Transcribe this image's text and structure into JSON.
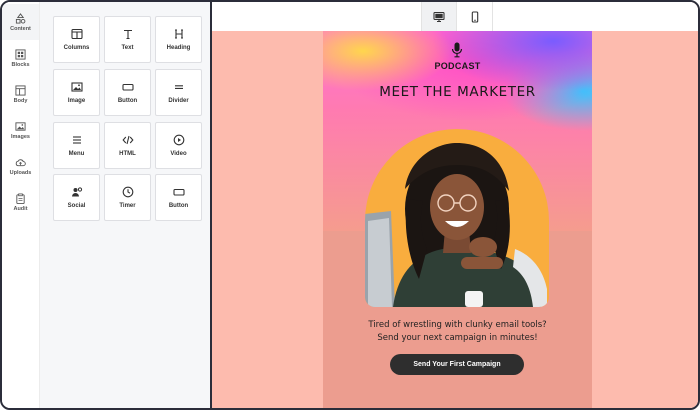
{
  "sidebar": {
    "items": [
      {
        "label": "Content",
        "icon": "shapes-icon",
        "active": true
      },
      {
        "label": "Blocks",
        "icon": "blocks-icon"
      },
      {
        "label": "Body",
        "icon": "body-layout-icon"
      },
      {
        "label": "Images",
        "icon": "image-icon"
      },
      {
        "label": "Uploads",
        "icon": "cloud-upload-icon"
      },
      {
        "label": "Audit",
        "icon": "clipboard-icon"
      }
    ]
  },
  "tools": [
    {
      "label": "Columns",
      "icon": "columns-icon"
    },
    {
      "label": "Text",
      "icon": "text-icon"
    },
    {
      "label": "Heading",
      "icon": "heading-icon"
    },
    {
      "label": "Image",
      "icon": "image-icon"
    },
    {
      "label": "Button",
      "icon": "button-icon"
    },
    {
      "label": "Divider",
      "icon": "divider-icon"
    },
    {
      "label": "Menu",
      "icon": "menu-icon"
    },
    {
      "label": "HTML",
      "icon": "code-icon"
    },
    {
      "label": "Video",
      "icon": "video-icon"
    },
    {
      "label": "Social",
      "icon": "social-icon"
    },
    {
      "label": "Timer",
      "icon": "timer-icon"
    },
    {
      "label": "Button",
      "icon": "button-icon"
    }
  ],
  "device_toggle": {
    "active": "desktop",
    "options": [
      "desktop-icon",
      "mobile-icon"
    ]
  },
  "email": {
    "podcast_label": "PODCAST",
    "headline": "MEET THE MARKETER",
    "tagline_line1": "Tired of wrestling with clunky email tools?",
    "tagline_line2": "Send your next campaign in minutes!",
    "cta_label": "Send Your First Campaign"
  },
  "colors": {
    "canvas_bg": "#fdbbae",
    "email_bg": "#ec9d8f",
    "arch": "#f9ad3e",
    "cta_bg": "#2e2e2e",
    "frame_border": "#2b2d3a"
  }
}
